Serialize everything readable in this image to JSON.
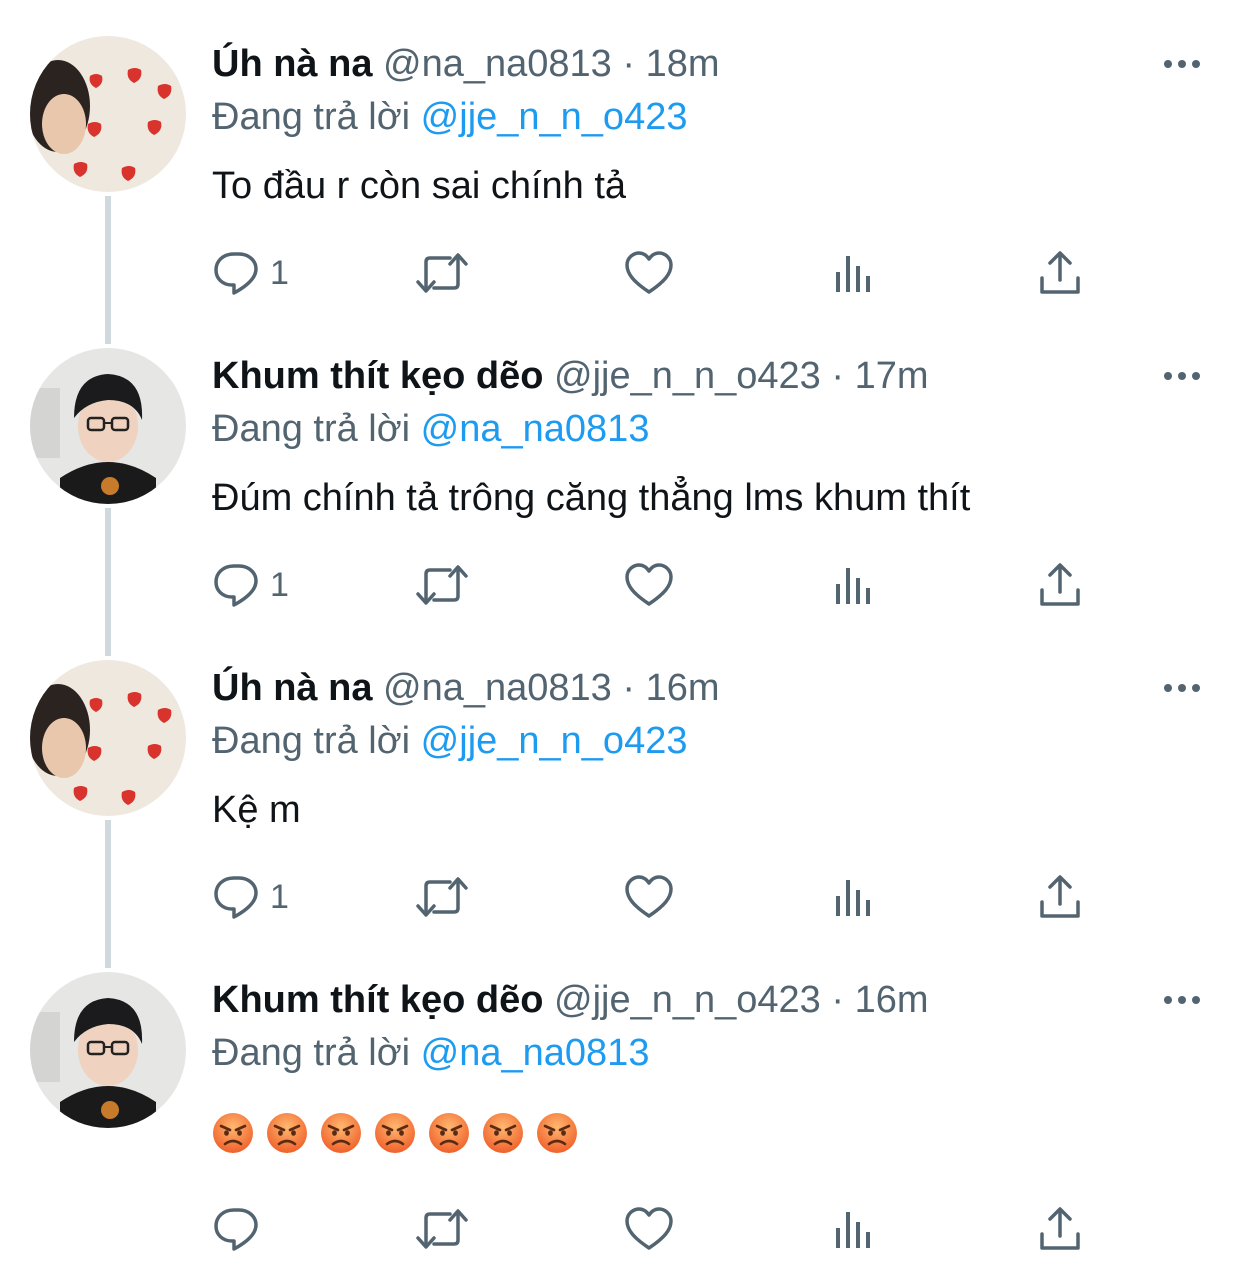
{
  "colors": {
    "name": "#0f1419",
    "secondary": "#536471",
    "mention": "#1d9bf0",
    "thread_line": "#cfd9de"
  },
  "tweets": [
    {
      "name": "Úh nà na",
      "handle": "@na_na0813",
      "dot": "·",
      "time": "18m",
      "reply_prefix": "Đang trả lời",
      "reply_mention": "@jje_n_n_o423",
      "text": "To đầu r còn sai chính tả",
      "reply_count": "1",
      "avatar": "strawberries-avatar"
    },
    {
      "name": "Khum thít kẹo dẽo",
      "handle": "@jje_n_n_o423",
      "dot": "·",
      "time": "17m",
      "reply_prefix": "Đang trả lời",
      "reply_mention": "@na_na0813",
      "text": "Đúm chính tả trông căng thẳng lms khum thít",
      "reply_count": "1",
      "avatar": "glasses-boy-avatar"
    },
    {
      "name": "Úh nà na",
      "handle": "@na_na0813",
      "dot": "·",
      "time": "16m",
      "reply_prefix": "Đang trả lời",
      "reply_mention": "@jje_n_n_o423",
      "text": "Kệ m",
      "reply_count": "1",
      "avatar": "strawberries-avatar"
    },
    {
      "name": "Khum thít kẹo dẽo",
      "handle": "@jje_n_n_o423",
      "dot": "·",
      "time": "16m",
      "reply_prefix": "Đang trả lời",
      "reply_mention": "@na_na0813",
      "text": "😡😡😡😡😡😡😡",
      "reply_count": "",
      "avatar": "glasses-boy-avatar",
      "emoji_count": 7,
      "emoji_name": "angry-face-emoji"
    }
  ],
  "icons": {
    "reply": "reply-icon",
    "retweet": "retweet-icon",
    "like": "heart-icon",
    "views": "views-icon",
    "share": "share-icon",
    "more": "more-options-icon"
  }
}
